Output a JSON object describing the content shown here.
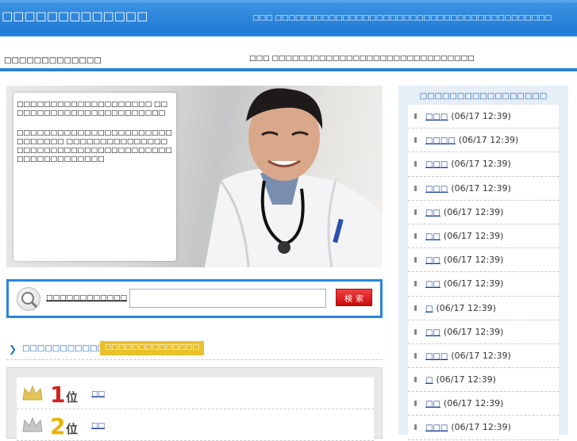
{
  "header": {
    "site_title": "□□□□□□□□□□□□□",
    "tagline": "□□□ □□□□□□□□□□□□□□□□□□□□□□□□□□□□□□□□□□□□□□□□□"
  },
  "subbar": {
    "left_text": "□□□□□□□□□□□□□",
    "right_text": "□□□ □□□□□□□□□□□□□□□□□□□□□□□□□□□□□□"
  },
  "hero": {
    "paragraph1": "□□□□□□□□□□□□□□□□□□□□ □□□□□□□□□□□□□□□□□□□□□□□□",
    "paragraph2": "□□□□□□□□□□□□□□□□□□□□□□□□□□□□□□ □□□□□□□□□□□□□□□□□□□□□□□□□□□□□□□□□□□□□□□□□□□□□□□□□□□"
  },
  "search": {
    "label": "□□□□□□□□□□□□",
    "input_value": "",
    "button_label": "検索"
  },
  "ranking": {
    "title": "□□□□□□□□□□□□□□□□□□",
    "badge": "□□□□□□□□□□□□□□",
    "items": [
      {
        "rank": "1",
        "suffix": "位",
        "link": "□□",
        "color": "#d42020"
      },
      {
        "rank": "2",
        "suffix": "位",
        "link": "□□",
        "color": "#e8b400"
      }
    ]
  },
  "sidebar": {
    "title": "□□□□□□□□□□□□□□□□□",
    "items": [
      {
        "link": "□□□",
        "time": "(06/17 12:39)"
      },
      {
        "link": "□□□□",
        "time": "(06/17 12:39)"
      },
      {
        "link": "□□□",
        "time": "(06/17 12:39)"
      },
      {
        "link": "□□□",
        "time": "(06/17 12:39)"
      },
      {
        "link": "□□",
        "time": "(06/17 12:39)"
      },
      {
        "link": "□□",
        "time": "(06/17 12:39)"
      },
      {
        "link": "□□",
        "time": "(06/17 12:39)"
      },
      {
        "link": "□□",
        "time": "(06/17 12:39)"
      },
      {
        "link": "□",
        "time": "(06/17 12:39)"
      },
      {
        "link": "□□",
        "time": "(06/17 12:39)"
      },
      {
        "link": "□□□",
        "time": "(06/17 12:39)"
      },
      {
        "link": "□",
        "time": "(06/17 12:39)"
      },
      {
        "link": "□□",
        "time": "(06/17 12:39)"
      },
      {
        "link": "□□□",
        "time": "(06/17 12:39)"
      }
    ]
  }
}
